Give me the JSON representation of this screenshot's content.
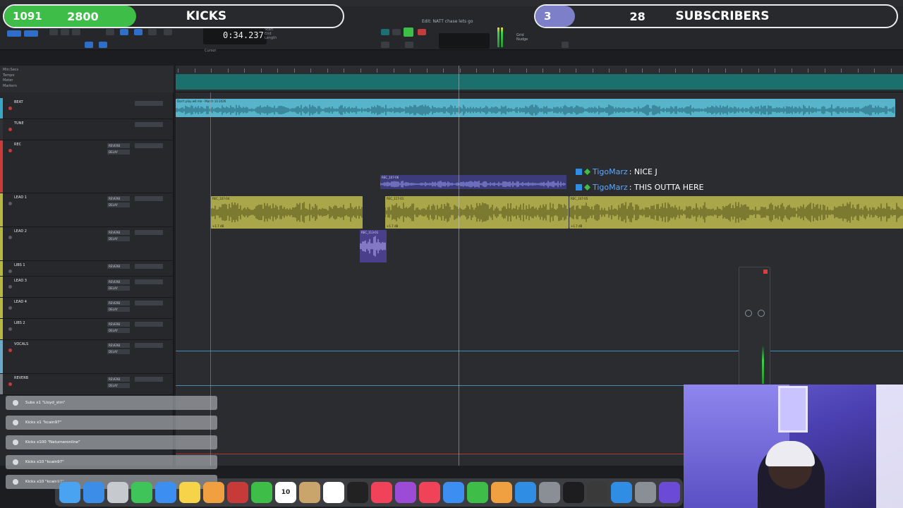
{
  "window": {
    "title": "Edit: NATT chase lets go",
    "time_counter": "0:34.237",
    "cursor_label": "Cursor"
  },
  "overlay": {
    "kicks": {
      "count": "1091",
      "label": "KICKS",
      "goal": "2800",
      "progress": 0.39,
      "color": "#3fbd49"
    },
    "subscribers": {
      "count": "3",
      "label": "SUBSCRIBERS",
      "goal": "28",
      "progress": 0.11,
      "color": "#7d7fc8"
    }
  },
  "rulers": [
    "Min:Secs",
    "Tempo",
    "Meter",
    "Markers"
  ],
  "tracks": [
    {
      "name": "BEAT",
      "color": "#3aa7c7"
    },
    {
      "name": "TUNE",
      "color": "#2f3136"
    },
    {
      "name": "REC",
      "color": "#cc3a3a"
    },
    {
      "name": "LEAD 1",
      "color": "#b6b83f"
    },
    {
      "name": "LEAD 2",
      "color": "#b6b83f"
    },
    {
      "name": "LIBS 1",
      "color": "#b6b83f"
    },
    {
      "name": "LEAD 3",
      "color": "#b6b83f"
    },
    {
      "name": "LEAD 4",
      "color": "#b6b83f"
    },
    {
      "name": "LIBS 2",
      "color": "#b6b83f"
    },
    {
      "name": "VOCALS",
      "color": "#6aa9c9"
    },
    {
      "name": "REVERB",
      "color": "#7b7f86"
    }
  ],
  "sends": {
    "reverb": "REVERB",
    "delay": "DELAY"
  },
  "clips": {
    "beat": "Don't play wit me - March 10 2026",
    "rec": "REC_107-06",
    "lead_a": "REC_107-04",
    "lead_b": "REC_117-01",
    "lead_c": "REC_107-05",
    "lead2": "REC_113-01",
    "gain": "+1.7 dB"
  },
  "chat": [
    {
      "user": "TigoMarz",
      "message": ": NICE J"
    },
    {
      "user": "TigoMarz",
      "message": ": THIS OUTTA HERE"
    }
  ],
  "alerts": [
    "Subs x1 \"Lloyd_stm\"",
    "Kicks x1 \"kcain97\"",
    "Kicks x100 \"Naturneronline\"",
    "Kicks x10 \"kcain97\"",
    "Kicks x10 \"kcain97\""
  ],
  "dock": {
    "calendar_day": "10",
    "apps": [
      "Finder",
      "Safari",
      "Launchpad",
      "Messages",
      "Mail",
      "Notes",
      "Photos",
      "Photo Booth",
      "FaceTime",
      "Calendar",
      "Contacts",
      "Reminders",
      "Apple TV",
      "Music",
      "Podcasts",
      "News",
      "Keynote",
      "Numbers",
      "Pages",
      "App Store",
      "System Settings",
      "Melodyne",
      "iLok",
      "Quick",
      "Scope",
      "Pro Tools"
    ]
  }
}
